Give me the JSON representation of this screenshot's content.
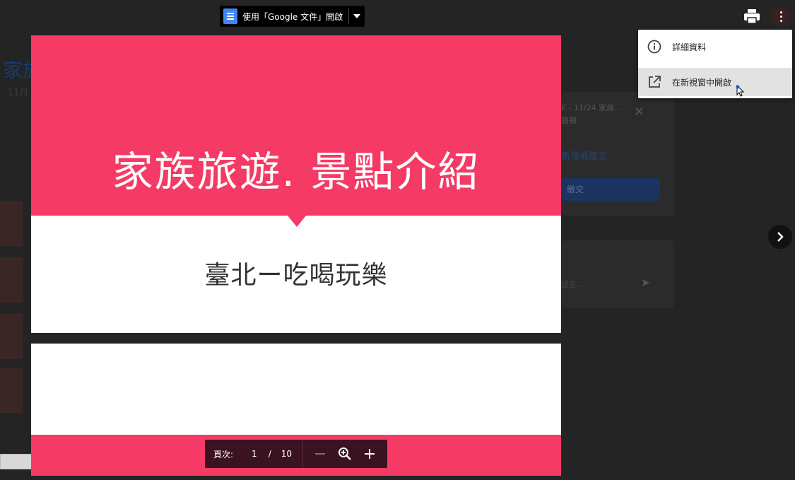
{
  "toolbar": {
    "open_with_label": "使用「Google 文件」開啟"
  },
  "menu": {
    "items": [
      {
        "label": "詳細資料",
        "icon": "info-icon"
      },
      {
        "label": "在新視窗中開啟",
        "icon": "open-in-new-icon"
      }
    ]
  },
  "slides": {
    "slide1_title": "家族旅遊. 景點介紹",
    "slide1_subtitle": "臺北ー吃喝玩樂"
  },
  "pager": {
    "label": "頁次:",
    "current": "1",
    "separator": "/",
    "total": "10"
  },
  "background": {
    "title": "家旅",
    "subtitle": "- 11月",
    "card_title": "E - 11/24 家族...",
    "card_subtitle": "簡報",
    "card_link": "新增或建立",
    "card_button": "繳交",
    "comment_hint": "留言..."
  },
  "colors": {
    "slide_accent": "#f43a65",
    "pager_bg": "#3b1220",
    "docs_blue": "#4285f4"
  }
}
